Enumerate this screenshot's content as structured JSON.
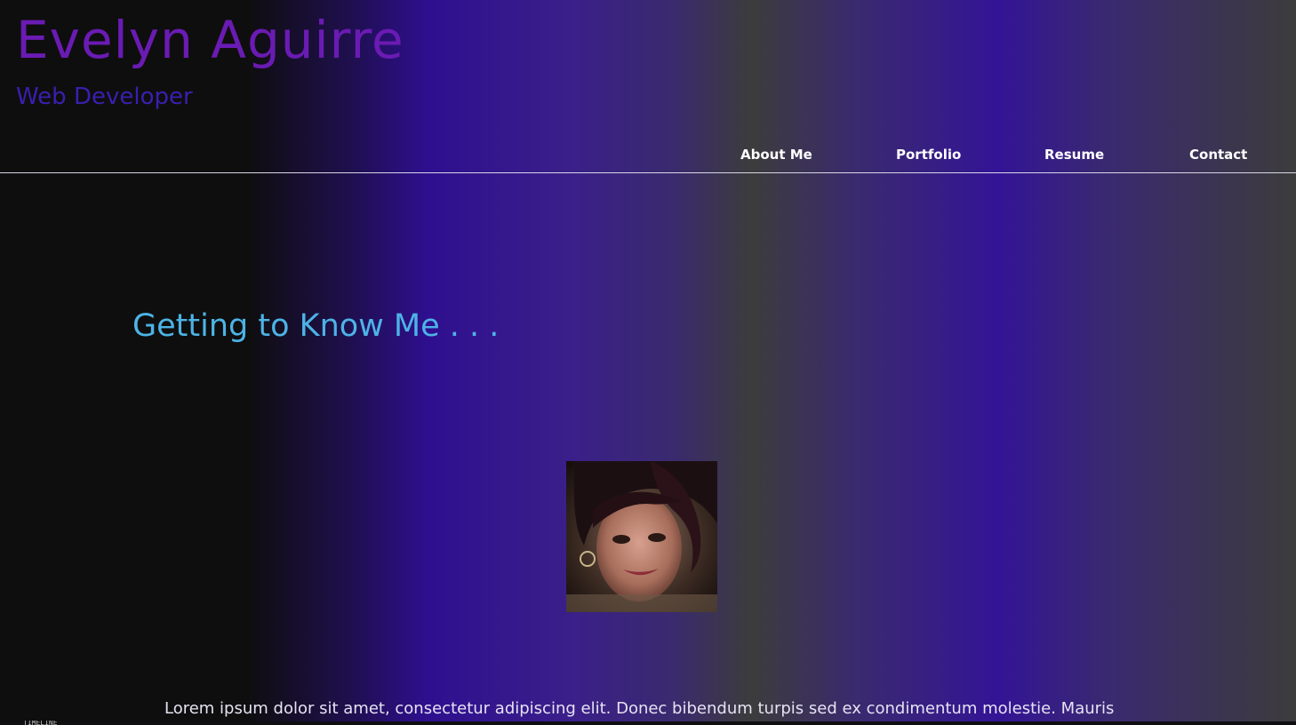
{
  "header": {
    "title": "Evelyn Aguirre",
    "subtitle": "Web Developer"
  },
  "nav": {
    "items": [
      {
        "label": "About Me"
      },
      {
        "label": "Portfolio"
      },
      {
        "label": "Resume"
      },
      {
        "label": "Contact"
      }
    ]
  },
  "about": {
    "heading": "Getting to Know Me . . .",
    "bio": "Lorem ipsum dolor sit amet, consectetur adipiscing elit. Donec bibendum turpis sed ex condimentum molestie. Mauris"
  },
  "devtools": {
    "timeline_label": "TIMELINE"
  },
  "colors": {
    "title": "#6a1bb3",
    "subtitle": "#3a1fb0",
    "heading": "#4db3e6",
    "nav_text": "#ffffff"
  }
}
